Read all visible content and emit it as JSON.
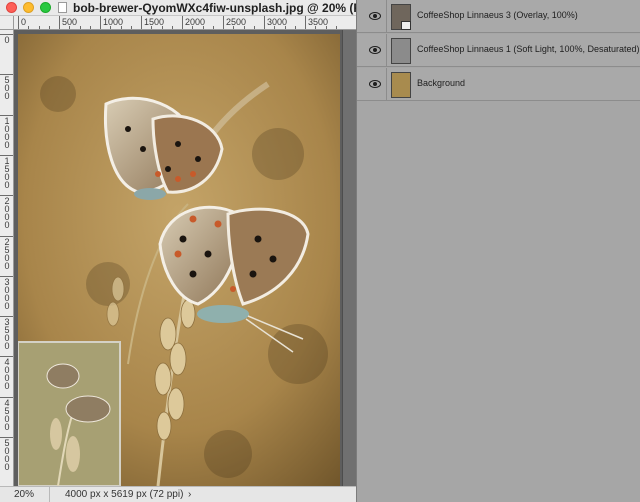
{
  "document": {
    "title": "bob-brewer-QyomWXc4fiw-unsplash.jpg @ 20% (R...",
    "zoom": "20%",
    "info": "4000 px x 5619 px (72 ppi)",
    "info_arrow": "›",
    "hruler_labels": [
      "0",
      "500",
      "1000",
      "1500",
      "2000",
      "2500",
      "3000",
      "3500"
    ],
    "vruler_labels": [
      "0",
      "500",
      "1000",
      "1500",
      "2000",
      "2500",
      "3000",
      "3500",
      "4000",
      "4500",
      "5000"
    ]
  },
  "layers": [
    {
      "name": "CoffeeShop Linnaeus 3 (Overlay, 100%)",
      "visible": true,
      "thumb": "texture-dark",
      "smart": true
    },
    {
      "name": "CoffeeShop Linnaeus 1 (Soft Light, 100%, Desaturated)",
      "visible": true,
      "thumb": "texture-grey",
      "smart": false
    },
    {
      "name": "Background",
      "visible": true,
      "thumb": "photo",
      "smart": false
    }
  ],
  "colors": {
    "texture_base": "#a9864a",
    "preview_base": "#a7a073"
  }
}
